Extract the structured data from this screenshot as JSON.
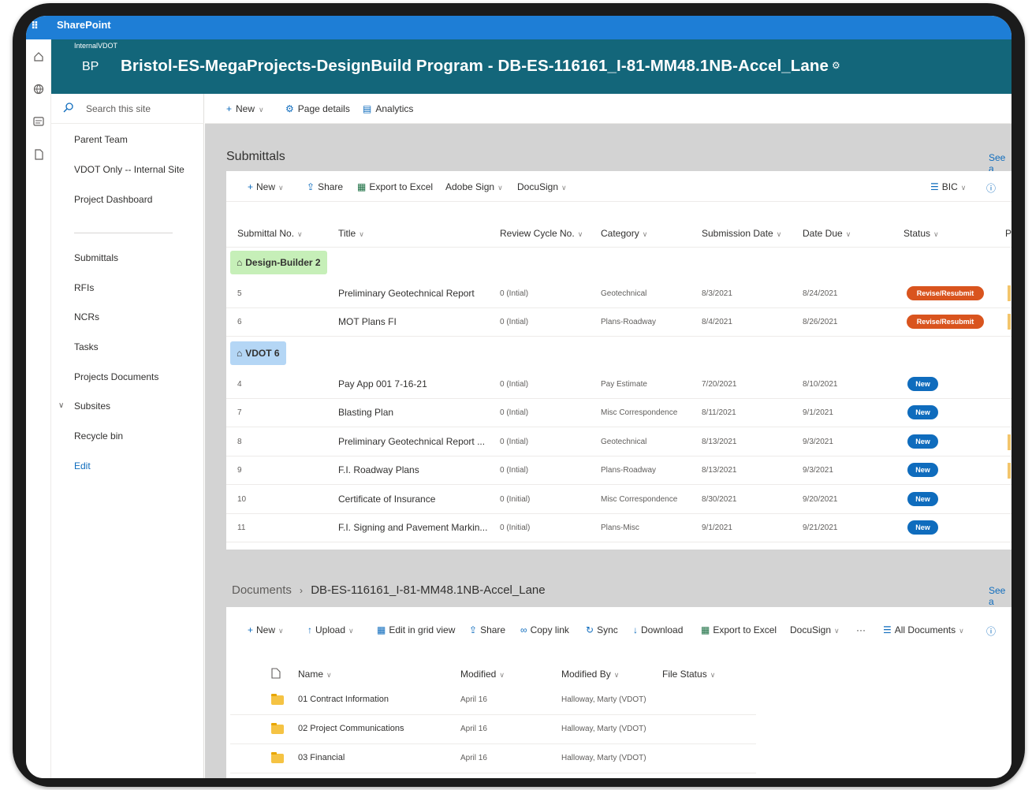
{
  "suite": {
    "brand": "SharePoint"
  },
  "site": {
    "hub_name": "InternalVDOT",
    "initials": "BP",
    "title": "Bristol-ES-MegaProjects-DesignBuild Program - DB-ES-116161_I-81-MM48.1NB-Accel_Lane"
  },
  "left_nav": {
    "search_placeholder": "Search this site",
    "items": [
      "Parent Team",
      "VDOT Only -- Internal Site",
      "Project Dashboard",
      "Submittals",
      "RFIs",
      "NCRs",
      "Tasks",
      "Projects Documents",
      "Subsites",
      "Recycle bin",
      "Edit"
    ]
  },
  "command_bar": {
    "new": "New",
    "page_details": "Page details",
    "analytics": "Analytics"
  },
  "submittals": {
    "title": "Submittals",
    "see_all": "See a",
    "toolbar": {
      "new": "New",
      "share": "Share",
      "export": "Export to Excel",
      "adobe_sign": "Adobe Sign",
      "docusign": "DocuSign",
      "view": "BIC"
    },
    "columns": [
      "Submittal No.",
      "Title",
      "Review Cycle No.",
      "Category",
      "Submission Date",
      "Date Due",
      "Status",
      "P"
    ],
    "groups": [
      {
        "label": "Design-Builder 2",
        "color": "#c6efb8",
        "rows": [
          {
            "no": "5",
            "title": "Preliminary Geotechnical Report",
            "cycle": "0 (Intial)",
            "category": "Geotechnical",
            "submitted": "8/3/2021",
            "due": "8/24/2021",
            "status": "Revise/Resubmit"
          },
          {
            "no": "6",
            "title": "MOT Plans FI",
            "cycle": "0 (Intial)",
            "category": "Plans-Roadway",
            "submitted": "8/4/2021",
            "due": "8/26/2021",
            "status": "Revise/Resubmit"
          }
        ]
      },
      {
        "label": "VDOT 6",
        "color": "#b4d6f5",
        "rows": [
          {
            "no": "4",
            "title": "Pay App 001 7-16-21",
            "cycle": "0 (Intial)",
            "category": "Pay Estimate",
            "submitted": "7/20/2021",
            "due": "8/10/2021",
            "status": "New"
          },
          {
            "no": "7",
            "title": "Blasting Plan",
            "cycle": "0 (Intial)",
            "category": "Misc Correspondence",
            "submitted": "8/11/2021",
            "due": "9/1/2021",
            "status": "New"
          },
          {
            "no": "8",
            "title": "Preliminary Geotechnical Report ...",
            "cycle": "0 (Intial)",
            "category": "Geotechnical",
            "submitted": "8/13/2021",
            "due": "9/3/2021",
            "status": "New"
          },
          {
            "no": "9",
            "title": "F.I. Roadway Plans",
            "cycle": "0 (Intial)",
            "category": "Plans-Roadway",
            "submitted": "8/13/2021",
            "due": "9/3/2021",
            "status": "New"
          },
          {
            "no": "10",
            "title": "Certificate of Insurance",
            "cycle": "0 (Initial)",
            "category": "Misc Correspondence",
            "submitted": "8/30/2021",
            "due": "9/20/2021",
            "status": "New"
          },
          {
            "no": "11",
            "title": "F.I. Signing and Pavement Markin...",
            "cycle": "0 (Initial)",
            "category": "Plans-Misc",
            "submitted": "9/1/2021",
            "due": "9/21/2021",
            "status": "New"
          }
        ]
      }
    ],
    "status_colors": {
      "Revise/Resubmit": "#d9541e",
      "New": "#0f6cbd"
    }
  },
  "documents": {
    "crumb_root": "Documents",
    "crumb_leaf": "DB-ES-116161_I-81-MM48.1NB-Accel_Lane",
    "see_all": "See a",
    "toolbar": {
      "new": "New",
      "upload": "Upload",
      "edit_grid": "Edit in grid view",
      "share": "Share",
      "copy_link": "Copy link",
      "sync": "Sync",
      "download": "Download",
      "export": "Export to Excel",
      "docusign": "DocuSign",
      "more": "···",
      "view": "All Documents"
    },
    "columns": [
      "Name",
      "Modified",
      "Modified By",
      "File Status"
    ],
    "rows": [
      {
        "name": "01 Contract Information",
        "modified": "April 16",
        "by": "Halloway, Marty (VDOT)"
      },
      {
        "name": "02 Project Communications",
        "modified": "April 16",
        "by": "Halloway, Marty (VDOT)"
      },
      {
        "name": "03 Financial",
        "modified": "April 16",
        "by": "Halloway, Marty (VDOT)"
      }
    ]
  },
  "theme": {
    "suite_blue": "#1e7ed6",
    "header_teal": "#13667a",
    "link_blue": "#0f6cbd"
  }
}
